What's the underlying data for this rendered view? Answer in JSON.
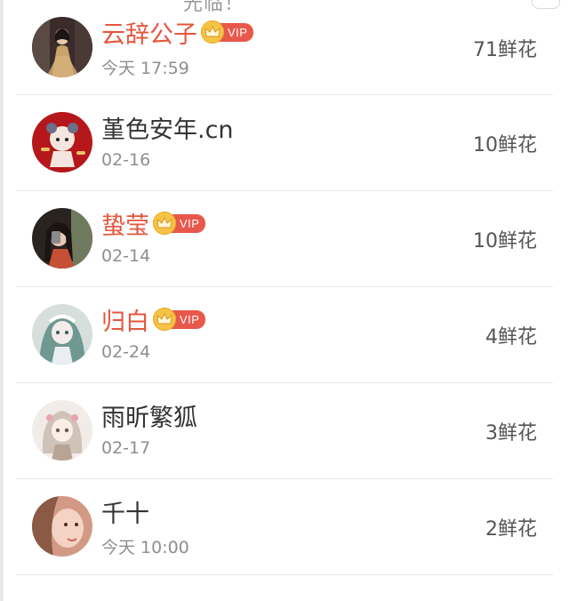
{
  "header": {
    "partial_text": "光临！"
  },
  "rows": [
    {
      "name": "云辞公子",
      "vip": true,
      "vip_label": "VIP",
      "time": "今天 17:59",
      "flowers": "71鲜花",
      "avatar_colors": [
        "#3b2b2a",
        "#c9a36a"
      ]
    },
    {
      "name": "堇色安年.cn",
      "vip": false,
      "time": "02-16",
      "flowers": "10鲜花",
      "avatar_colors": [
        "#b5171b",
        "#f4e6df"
      ]
    },
    {
      "name": "蛰莹",
      "vip": true,
      "vip_label": "VIP",
      "time": "02-14",
      "flowers": "10鲜花",
      "avatar_colors": [
        "#2a2320",
        "#c55036"
      ]
    },
    {
      "name": "归白",
      "vip": true,
      "vip_label": "VIP",
      "time": "02-24",
      "flowers": "4鲜花",
      "avatar_colors": [
        "#6f9893",
        "#d6dfdb"
      ]
    },
    {
      "name": "雨昕繁狐",
      "vip": false,
      "time": "02-17",
      "flowers": "3鲜花",
      "avatar_colors": [
        "#f1ece8",
        "#b7a493"
      ]
    },
    {
      "name": "千十",
      "vip": false,
      "time": "今天 10:00",
      "flowers": "2鲜花",
      "avatar_colors": [
        "#d29a84",
        "#f5d3c4"
      ]
    }
  ]
}
